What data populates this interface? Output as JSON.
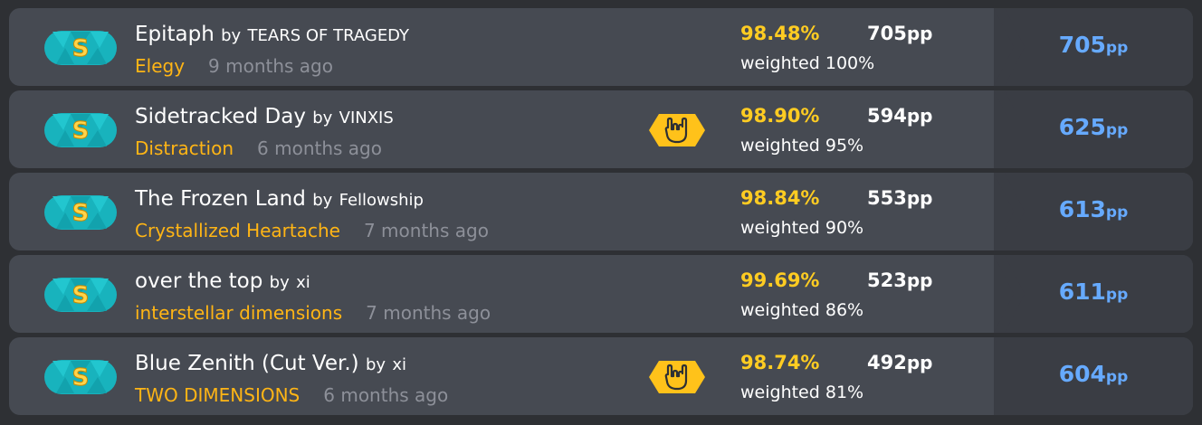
{
  "scores": [
    {
      "title": "Epitaph",
      "by": "by",
      "artist": "TEARS OF TRAGEDY",
      "difficulty": "Elegy",
      "time_ago": "9 months ago",
      "accuracy": "98.48%",
      "raw_pp": "705",
      "weighted": "weighted 100%",
      "weighted_pp": "705",
      "has_mod": false
    },
    {
      "title": "Sidetracked Day",
      "by": "by",
      "artist": "VINXIS",
      "difficulty": "Distraction",
      "time_ago": "6 months ago",
      "accuracy": "98.90%",
      "raw_pp": "594",
      "weighted": "weighted 95%",
      "weighted_pp": "625",
      "has_mod": true
    },
    {
      "title": "The Frozen Land",
      "by": "by",
      "artist": "Fellowship",
      "difficulty": "Crystallized Heartache",
      "time_ago": "7 months ago",
      "accuracy": "98.84%",
      "raw_pp": "553",
      "weighted": "weighted 90%",
      "weighted_pp": "613",
      "has_mod": false
    },
    {
      "title": "over the top",
      "by": "by",
      "artist": "xi",
      "difficulty": "interstellar dimensions",
      "time_ago": "7 months ago",
      "accuracy": "99.69%",
      "raw_pp": "523",
      "weighted": "weighted 86%",
      "weighted_pp": "611",
      "has_mod": false
    },
    {
      "title": "Blue Zenith (Cut Ver.)",
      "by": "by",
      "artist": "xi",
      "difficulty": "TWO DIMENSIONS",
      "time_ago": "6 months ago",
      "accuracy": "98.74%",
      "raw_pp": "492",
      "weighted": "weighted 81%",
      "weighted_pp": "604",
      "has_mod": true
    }
  ],
  "rank_letter": "S",
  "pp_unit": "pp",
  "rank_icon": "rank-s-icon",
  "mod_icon": "rock-hand-mod-icon",
  "colors": {
    "background": "#2e3034",
    "row": "#464a52",
    "row_right": "#3a3d44",
    "difficulty": "#ffb515",
    "time": "#8d9099",
    "accuracy": "#ffcc22",
    "weighted_pp": "#66aaff",
    "rank_badge": "#18b3bd",
    "mod_badge": "#ffc21a"
  }
}
